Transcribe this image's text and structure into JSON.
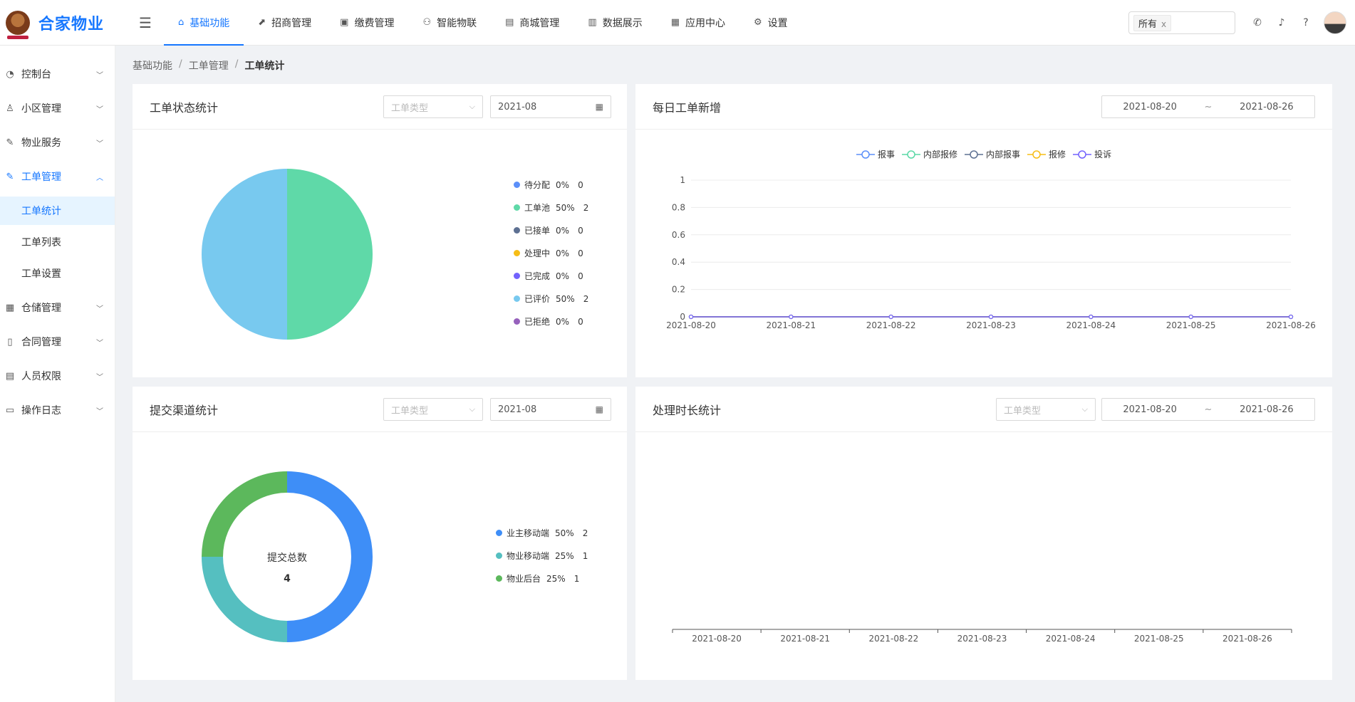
{
  "app": {
    "name": "合家物业"
  },
  "topnav": [
    {
      "label": "基础功能",
      "icon": "home-icon",
      "glyph": "⌂",
      "active": true
    },
    {
      "label": "招商管理",
      "icon": "chart-icon",
      "glyph": "⬈",
      "active": false
    },
    {
      "label": "缴费管理",
      "icon": "receipt-icon",
      "glyph": "▣",
      "active": false
    },
    {
      "label": "智能物联",
      "icon": "network-icon",
      "glyph": "⚇",
      "active": false
    },
    {
      "label": "商城管理",
      "icon": "shop-icon",
      "glyph": "▤",
      "active": false
    },
    {
      "label": "数据展示",
      "icon": "bar-chart-icon",
      "glyph": "▥",
      "active": false
    },
    {
      "label": "应用中心",
      "icon": "grid-icon",
      "glyph": "▦",
      "active": false
    },
    {
      "label": "设置",
      "icon": "gear-icon",
      "glyph": "⚙",
      "active": false
    }
  ],
  "scope": {
    "tag": "所有",
    "close": "x"
  },
  "sidebar": {
    "items": [
      {
        "label": "控制台",
        "icon": "dashboard-icon",
        "glyph": "◔",
        "open": false
      },
      {
        "label": "小区管理",
        "icon": "users-icon",
        "glyph": "♙",
        "open": false
      },
      {
        "label": "物业服务",
        "icon": "wrench-icon",
        "glyph": "✎",
        "open": false
      },
      {
        "label": "工单管理",
        "icon": "tool-icon",
        "glyph": "✎",
        "open": true,
        "children": [
          {
            "label": "工单统计",
            "active": true
          },
          {
            "label": "工单列表",
            "active": false
          },
          {
            "label": "工单设置",
            "active": false
          }
        ]
      },
      {
        "label": "仓储管理",
        "icon": "warehouse-icon",
        "glyph": "▦",
        "open": false
      },
      {
        "label": "合同管理",
        "icon": "file-icon",
        "glyph": "▯",
        "open": false
      },
      {
        "label": "人员权限",
        "icon": "id-card-icon",
        "glyph": "▤",
        "open": false
      },
      {
        "label": "操作日志",
        "icon": "log-icon",
        "glyph": "▭",
        "open": false
      }
    ]
  },
  "breadcrumb": [
    "基础功能",
    "工单管理",
    "工单统计"
  ],
  "cards": {
    "status": {
      "title": "工单状态统计",
      "type_placeholder": "工单类型",
      "month": "2021-08"
    },
    "daily": {
      "title": "每日工单新增",
      "start": "2021-08-20",
      "end": "2021-08-26",
      "tilde": "~"
    },
    "channel": {
      "title": "提交渠道统计",
      "type_placeholder": "工单类型",
      "month": "2021-08",
      "center_label": "提交总数",
      "center_value": "4"
    },
    "duration": {
      "title": "处理时长统计",
      "type_placeholder": "工单类型",
      "start": "2021-08-20",
      "end": "2021-08-26",
      "tilde": "~"
    }
  },
  "chart_data": [
    {
      "type": "pie",
      "slices": [
        {
          "name": "待分配",
          "percent": "0%",
          "value": 0,
          "color": "#5b8ff9"
        },
        {
          "name": "工单池",
          "percent": "50%",
          "value": 2,
          "color": "#5fd9a8"
        },
        {
          "name": "已接单",
          "percent": "0%",
          "value": 0,
          "color": "#5d7092"
        },
        {
          "name": "处理中",
          "percent": "0%",
          "value": 0,
          "color": "#f6bd16"
        },
        {
          "name": "已完成",
          "percent": "0%",
          "value": 0,
          "color": "#7262fd"
        },
        {
          "name": "已评价",
          "percent": "50%",
          "value": 2,
          "color": "#78c9ef"
        },
        {
          "name": "已拒绝",
          "percent": "0%",
          "value": 0,
          "color": "#9661bc"
        }
      ]
    },
    {
      "type": "line",
      "x": [
        "2021-08-20",
        "2021-08-21",
        "2021-08-22",
        "2021-08-23",
        "2021-08-24",
        "2021-08-25",
        "2021-08-26"
      ],
      "yticks": [
        "0",
        "0.2",
        "0.4",
        "0.6",
        "0.8",
        "1"
      ],
      "ylim": [
        0,
        1
      ],
      "series": [
        {
          "name": "报事",
          "color": "#5b8ff9",
          "values": [
            0,
            0,
            0,
            0,
            0,
            0,
            0
          ]
        },
        {
          "name": "内部报修",
          "color": "#5ad8a6",
          "values": [
            0,
            0,
            0,
            0,
            0,
            0,
            0
          ]
        },
        {
          "name": "内部报事",
          "color": "#5d7092",
          "values": [
            0,
            0,
            0,
            0,
            0,
            0,
            0
          ]
        },
        {
          "name": "报修",
          "color": "#f6bd16",
          "values": [
            0,
            0,
            0,
            0,
            0,
            0,
            0
          ]
        },
        {
          "name": "投诉",
          "color": "#7262fd",
          "values": [
            0,
            0,
            0,
            0,
            0,
            0,
            0
          ]
        }
      ],
      "grid": true,
      "legend": "top-center"
    },
    {
      "type": "pie",
      "donut": true,
      "slices": [
        {
          "name": "业主移动端",
          "percent": "50%",
          "value": 2,
          "color": "#3e8ef7"
        },
        {
          "name": "物业移动端",
          "percent": "25%",
          "value": 1,
          "color": "#55bfc0"
        },
        {
          "name": "物业后台",
          "percent": "25%",
          "value": 1,
          "color": "#5cb85c"
        }
      ]
    },
    {
      "type": "bar",
      "categories": [
        "2021-08-20",
        "2021-08-21",
        "2021-08-22",
        "2021-08-23",
        "2021-08-24",
        "2021-08-25",
        "2021-08-26"
      ],
      "values": []
    }
  ]
}
